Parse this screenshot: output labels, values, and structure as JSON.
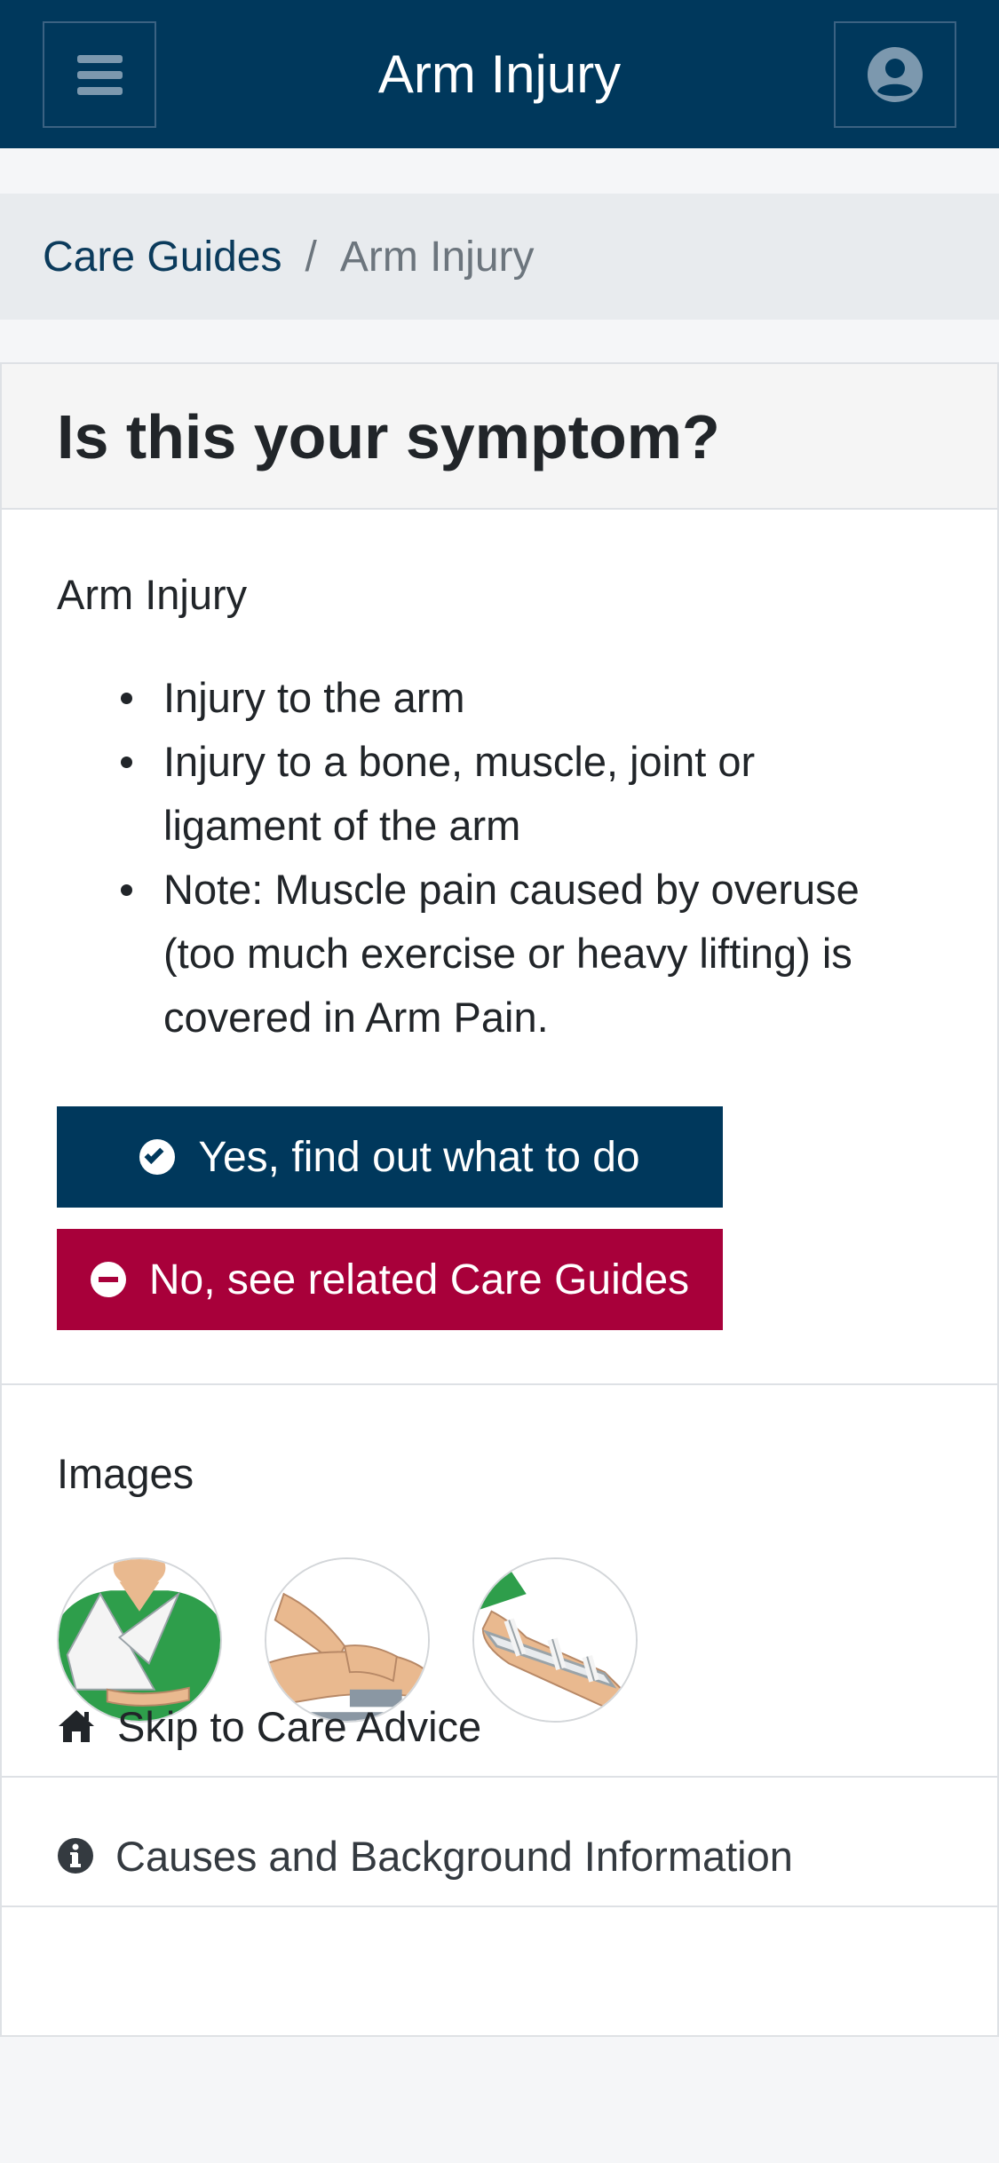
{
  "header": {
    "title": "Arm Injury",
    "menu_icon": "hamburger-menu-icon",
    "user_icon": "user-circle-icon"
  },
  "breadcrumb": {
    "parent": "Care Guides",
    "separator": "/",
    "current": "Arm Injury"
  },
  "card": {
    "title": "Is this your symptom?",
    "symptom_name": "Arm Injury",
    "bullets": [
      "Injury to the arm",
      "Injury to a bone, muscle, joint or ligament of the arm",
      "Note: Muscle pain caused by overuse (too much exercise or heavy lifting) is covered in Arm Pain."
    ],
    "yes_button": "Yes, find out what to do",
    "no_button": "No, see related Care Guides",
    "images_label": "Images",
    "skip_link": "Skip to Care Advice",
    "causes_link": "Causes and Background Information"
  },
  "colors": {
    "primary": "#00385c",
    "danger": "#a8003a",
    "breadcrumb_bg": "#e8ebee",
    "page_bg": "#f5f6f8"
  }
}
